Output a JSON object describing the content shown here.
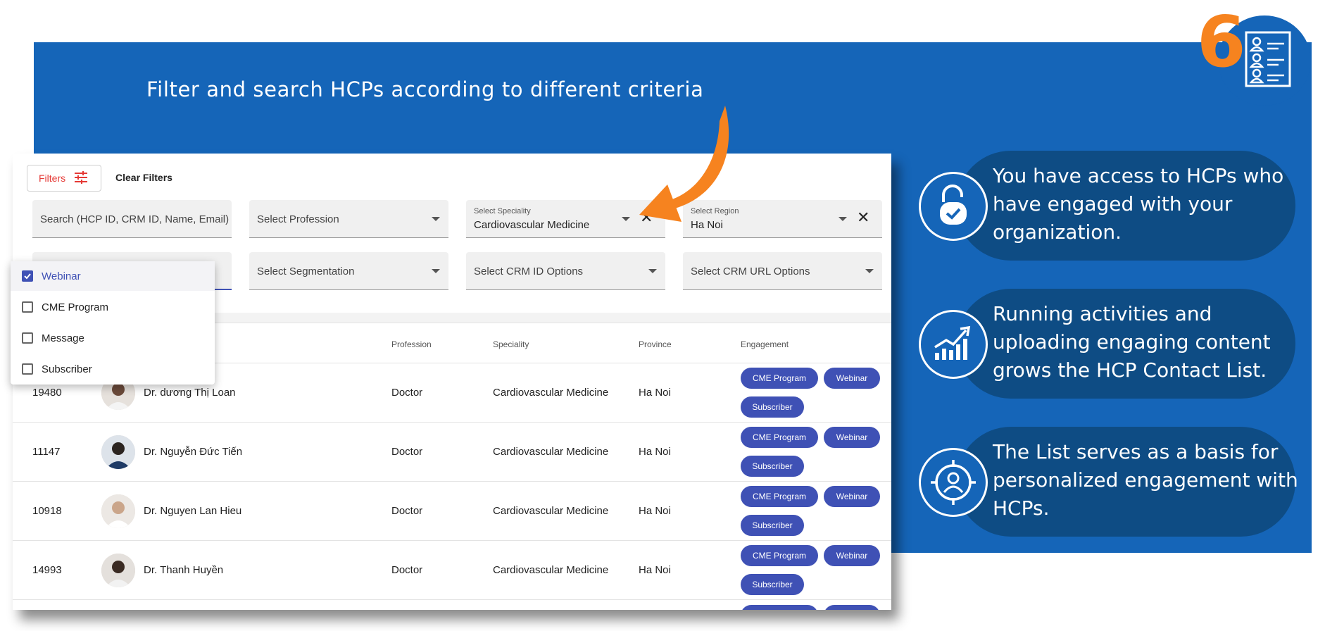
{
  "badge": {
    "number": "6",
    "icon": "contact-list-icon"
  },
  "headline": "Filter and search HCPs according to different criteria",
  "features": [
    {
      "icon": "unlock-icon",
      "text": "You have access to HCPs who have engaged with your organization."
    },
    {
      "icon": "growth-chart-icon",
      "text": "Running activities and uploading engaging content grows the HCP Contact List."
    },
    {
      "icon": "target-person-icon",
      "text": "The List serves as a basis for personalized engagement with HCPs."
    }
  ],
  "toolbar": {
    "filters_label": "Filters",
    "clear_label": "Clear Filters"
  },
  "filters": {
    "search_placeholder": "Search (HCP ID, CRM ID, Name, Email)",
    "profession_placeholder": "Select Profession",
    "speciality_label": "Select Speciality",
    "speciality_value": "Cardiovascular Medicine",
    "region_label": "Select Region",
    "region_value": "Ha Noi",
    "segmentation_placeholder": "Select Segmentation",
    "crm_id_placeholder": "Select CRM ID Options",
    "crm_url_placeholder": "Select CRM URL Options"
  },
  "engagement_dropdown": {
    "options": [
      {
        "label": "Webinar",
        "checked": true
      },
      {
        "label": "CME Program",
        "checked": false
      },
      {
        "label": "Message",
        "checked": false
      },
      {
        "label": "Subscriber",
        "checked": false
      }
    ]
  },
  "table": {
    "columns": [
      "Profession",
      "Speciality",
      "Province",
      "Engagement"
    ],
    "rows": [
      {
        "id": "19480",
        "name": "Dr. dương Thị Loan",
        "profession": "Doctor",
        "speciality": "Cardiovascular Medicine",
        "province": "Ha Noi",
        "engagement": [
          "CME Program",
          "Webinar",
          "Subscriber"
        ]
      },
      {
        "id": "11147",
        "name": "Dr. Nguyễn Đức Tiến",
        "profession": "Doctor",
        "speciality": "Cardiovascular Medicine",
        "province": "Ha Noi",
        "engagement": [
          "CME Program",
          "Webinar",
          "Subscriber"
        ]
      },
      {
        "id": "10918",
        "name": "Dr. Nguyen Lan Hieu",
        "profession": "Doctor",
        "speciality": "Cardiovascular Medicine",
        "province": "Ha Noi",
        "engagement": [
          "CME Program",
          "Webinar",
          "Subscriber"
        ]
      },
      {
        "id": "14993",
        "name": "Dr. Thanh Huyền",
        "profession": "Doctor",
        "speciality": "Cardiovascular Medicine",
        "province": "Ha Noi",
        "engagement": [
          "CME Program",
          "Webinar",
          "Subscriber"
        ]
      }
    ]
  },
  "colors": {
    "brand_blue": "#1565b8",
    "pill_navy": "#0e4c84",
    "accent_orange": "#f6831f",
    "chip_indigo": "#3f51b5",
    "filter_red": "#e53935"
  }
}
